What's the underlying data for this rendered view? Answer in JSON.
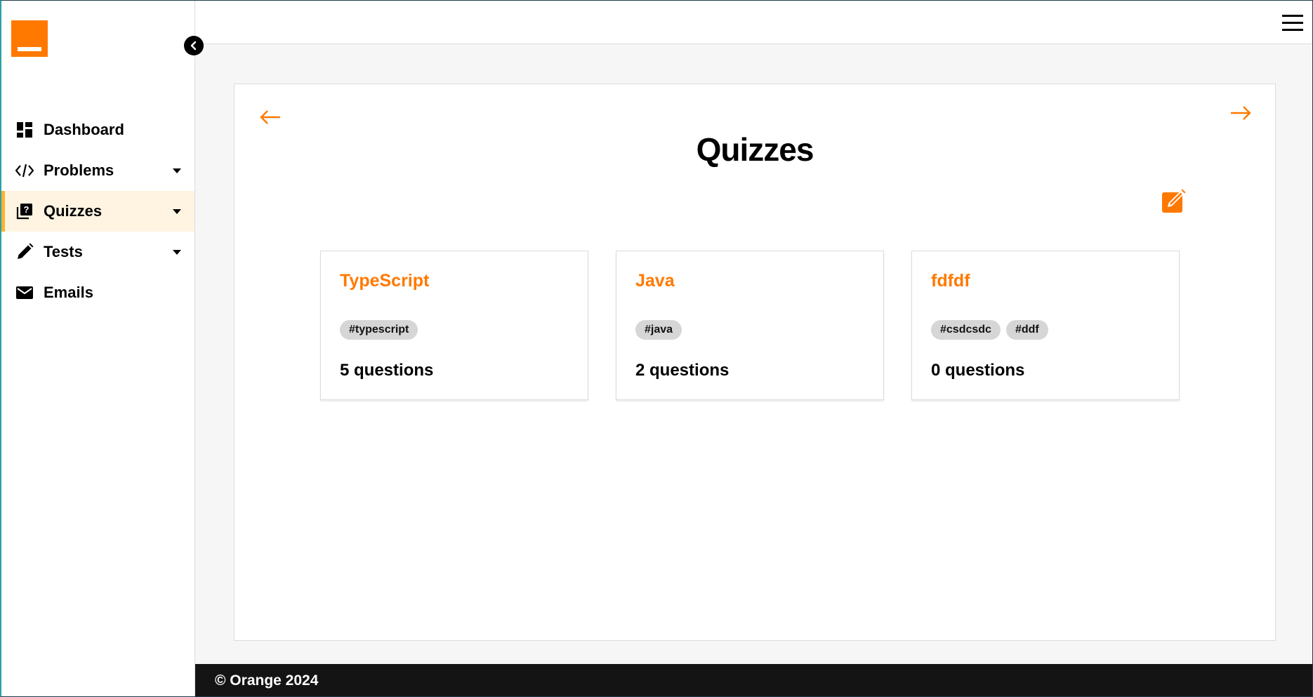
{
  "sidebar": {
    "items": [
      {
        "label": "Dashboard",
        "icon": "dashboard-icon",
        "has_submenu": false,
        "active": false
      },
      {
        "label": "Problems",
        "icon": "code-icon",
        "has_submenu": true,
        "active": false
      },
      {
        "label": "Quizzes",
        "icon": "quiz-icon",
        "has_submenu": true,
        "active": true
      },
      {
        "label": "Tests",
        "icon": "pencil-icon",
        "has_submenu": true,
        "active": false
      },
      {
        "label": "Emails",
        "icon": "mail-icon",
        "has_submenu": false,
        "active": false
      }
    ]
  },
  "header": {
    "menu_icon": "hamburger-icon"
  },
  "main": {
    "title": "Quizzes",
    "quizzes": [
      {
        "title": "TypeScript",
        "tags": [
          "#typescript"
        ],
        "count": "5 questions"
      },
      {
        "title": "Java",
        "tags": [
          "#java"
        ],
        "count": "2 questions"
      },
      {
        "title": "fdfdf",
        "tags": [
          "#csdcsdc",
          "#ddf"
        ],
        "count": "0 questions"
      }
    ]
  },
  "footer": {
    "text": "© Orange 2024"
  },
  "colors": {
    "accent": "#ff7900",
    "active_bg": "#fff4e2",
    "active_bar": "#ffb22e",
    "footer_bg": "#141414",
    "tag_bg": "#d6d6d6"
  }
}
